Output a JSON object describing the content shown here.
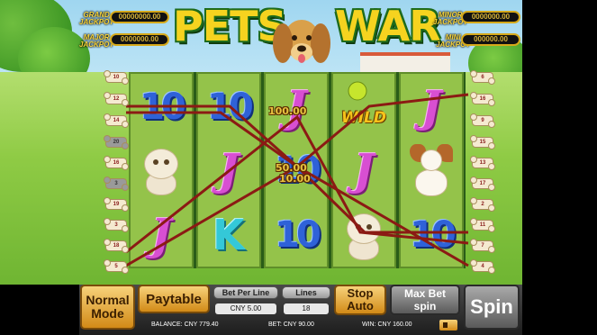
{
  "title": {
    "word1": "PETS",
    "word2": "WAR"
  },
  "jackpots": {
    "grand": {
      "label_line1": "GRAND",
      "label_line2": "JACKPOT",
      "value": "00000000.00"
    },
    "major": {
      "label_line1": "MAJOR",
      "label_line2": "JACKPOT",
      "value": "0000000.00"
    },
    "minor": {
      "label_line1": "MINOR",
      "label_line2": "JACKPOT",
      "value": "0000000.00"
    },
    "mini": {
      "label_line1": "MINI",
      "label_line2": "JACKPOT",
      "value": "000000.00"
    }
  },
  "reels": [
    [
      "10",
      "kitten",
      "J"
    ],
    [
      "10",
      "J",
      "K"
    ],
    [
      "J",
      "10",
      "10"
    ],
    [
      "WILD",
      "J",
      "kitten"
    ],
    [
      "J",
      "puppy",
      "10"
    ]
  ],
  "wins": {
    "win1": "100.00",
    "win2": "50.00",
    "win3": "10.00"
  },
  "paylines": {
    "left": [
      "10",
      "12",
      "14",
      "20",
      "16",
      "3",
      "19",
      "3",
      "18",
      "5"
    ],
    "right": [
      "6",
      "16",
      "9",
      "15",
      "13",
      "17",
      "2",
      "11",
      "7",
      "4"
    ],
    "color": "#8b1a14"
  },
  "controls": {
    "normal_mode_1": "Normal",
    "normal_mode_2": "Mode",
    "paytable": "Paytable",
    "bet_per_line_label": "Bet Per Line",
    "bet_per_line_value": "CNY 5.00",
    "lines_label": "Lines",
    "lines_value": "18",
    "stop_auto_1": "Stop",
    "stop_auto_2": "Auto",
    "max_bet_1": "Max Bet",
    "max_bet_2": "spin",
    "spin": "Spin"
  },
  "status": {
    "balance": "BALANCE: CNY 779.40",
    "bet": "BET: CNY 90.00",
    "win": "WIN: CNY 160.00"
  },
  "icons": {
    "sound": "speaker-icon"
  }
}
